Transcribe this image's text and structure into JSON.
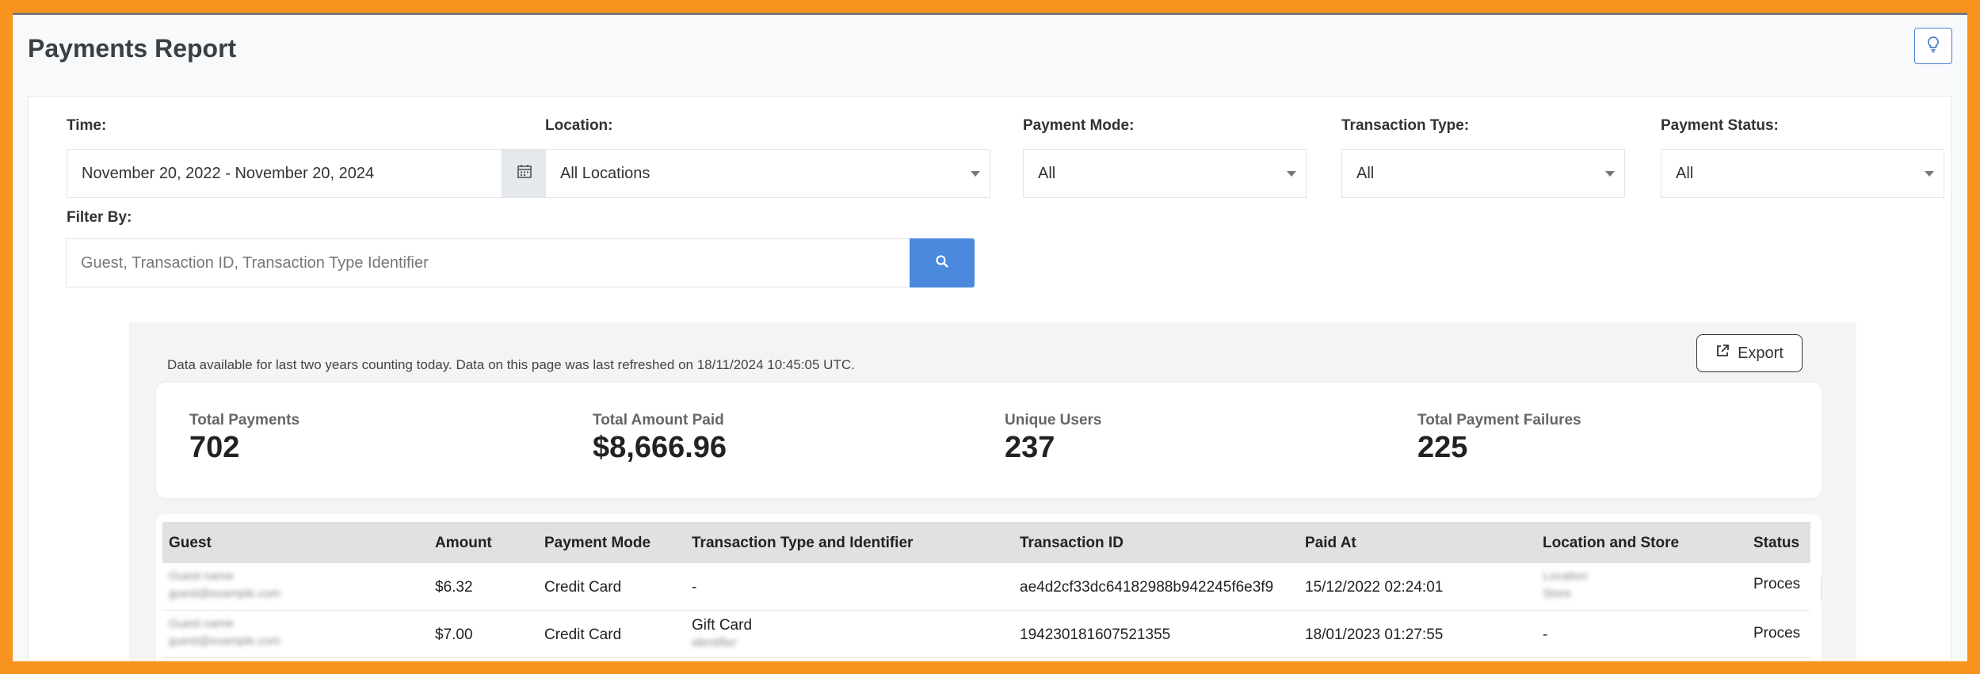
{
  "page": {
    "title": "Payments Report"
  },
  "filters": {
    "time": {
      "label": "Time:",
      "value": "November 20, 2022 - November 20, 2024"
    },
    "location": {
      "label": "Location:",
      "value": "All Locations"
    },
    "payment_mode": {
      "label": "Payment Mode:",
      "value": "All"
    },
    "transaction_type": {
      "label": "Transaction Type:",
      "value": "All"
    },
    "payment_status": {
      "label": "Payment Status:",
      "value": "All"
    },
    "filter_by": {
      "label": "Filter By:",
      "placeholder": "Guest, Transaction ID, Transaction Type Identifier"
    }
  },
  "report": {
    "notice": "Data available for last two years counting today. Data on this page was last refreshed on 18/11/2024 10:45:05 UTC.",
    "export_label": "Export",
    "stats": [
      {
        "label": "Total Payments",
        "value": "702"
      },
      {
        "label": "Total Amount Paid",
        "value": "$8,666.96"
      },
      {
        "label": "Unique Users",
        "value": "237"
      },
      {
        "label": "Total Payment Failures",
        "value": "225"
      }
    ],
    "table": {
      "columns": [
        "Guest",
        "Amount",
        "Payment Mode",
        "Transaction Type and Identifier",
        "Transaction ID",
        "Paid At",
        "Location and Store",
        "Status"
      ],
      "rows": [
        {
          "guest_name": "Guest name",
          "guest_email": "guest@example.com",
          "amount": "$6.32",
          "payment_mode": "Credit Card",
          "transaction_type": "-",
          "transaction_identifier": "",
          "transaction_id": "ae4d2cf33dc64182988b942245f6e3f9",
          "paid_at": "15/12/2022 02:24:01",
          "location": "Location",
          "store": "Store",
          "status": "Proces"
        },
        {
          "guest_name": "Guest name",
          "guest_email": "guest@example.com",
          "amount": "$7.00",
          "payment_mode": "Credit Card",
          "transaction_type": "Gift Card",
          "transaction_identifier": "identifier",
          "transaction_id": "194230181607521355",
          "paid_at": "18/01/2023 01:27:55",
          "location": "-",
          "store": "",
          "status": "Proces"
        }
      ]
    }
  },
  "colors": {
    "frame": "#f7931e",
    "accent": "#4a89dc"
  },
  "icons": {
    "hint": "lightbulb-icon",
    "calendar": "calendar-icon",
    "search": "search-icon",
    "export": "external-link-icon"
  }
}
